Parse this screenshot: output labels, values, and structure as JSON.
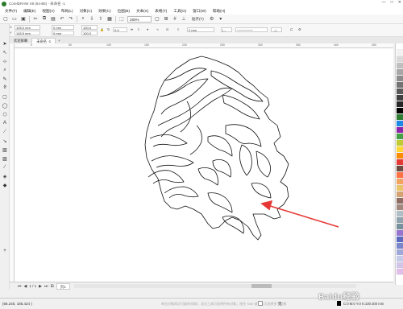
{
  "window": {
    "title": "CorelDRAW X8 (64-Bit) - 未命名 -1",
    "controls": [
      "—",
      "□",
      "✕"
    ]
  },
  "menu": [
    "文件(F)",
    "编辑(E)",
    "视图(V)",
    "布局(L)",
    "对象(C)",
    "效果(C)",
    "位图(B)",
    "文本(X)",
    "表格(T)",
    "工具(O)",
    "窗口(W)",
    "帮助(H)"
  ],
  "toolbar": {
    "zoom": "280%",
    "snap_label": "贴齐(T)"
  },
  "propbar": {
    "x": "105.0 mm",
    "y": "145.5 mm",
    "w": "0 mm",
    "h": "0 mm",
    "sx": "100.0",
    "sy": "100.0",
    "angle": "0.0",
    "outline_width": "2 mm"
  },
  "tabs": {
    "welcome": "欢迎屏幕",
    "doc": "未命名 -1",
    "add": "+"
  },
  "pagenav": {
    "counter": "1 / 1",
    "page_tab": "页1"
  },
  "status": {
    "coords": "(66.240, 185.424 )",
    "hint": "单击对象两次可旋转/倾斜；双击工具可选择所有对象；按住 Shift 键单击可选择多个对象",
    "fill_none": "无",
    "outline": "C:0 M:0 Y:0 K:100  200 mm"
  },
  "ruler_ticks": [
    "0",
    "50",
    "100",
    "150",
    "200",
    "250",
    "300",
    "350",
    "400",
    "450"
  ],
  "palette": [
    "#ffffff",
    "#f2f2f2",
    "#d9d9d9",
    "#bfbfbf",
    "#a6a6a6",
    "#8c8c8c",
    "#737373",
    "#595959",
    "#404040",
    "#262626",
    "#000000",
    "#2e7d32",
    "#1e88e5",
    "#8e24aa",
    "#43a047",
    "#c0ca33",
    "#fdd835",
    "#fb8c00",
    "#e53935",
    "#6d4c41",
    "#ff7043",
    "#f4a261",
    "#e9c46a",
    "#d4a373",
    "#8d6e63",
    "#a1887f",
    "#b0bec5",
    "#90a4ae",
    "#78909c",
    "#9575cd",
    "#5c6bc0",
    "#7986cb",
    "#9fa8da",
    "#c5cae9",
    "#d1c4e9",
    "#e1bee7"
  ],
  "watermark": "Baidu经验",
  "accent": {
    "arrow": "#e53935"
  }
}
